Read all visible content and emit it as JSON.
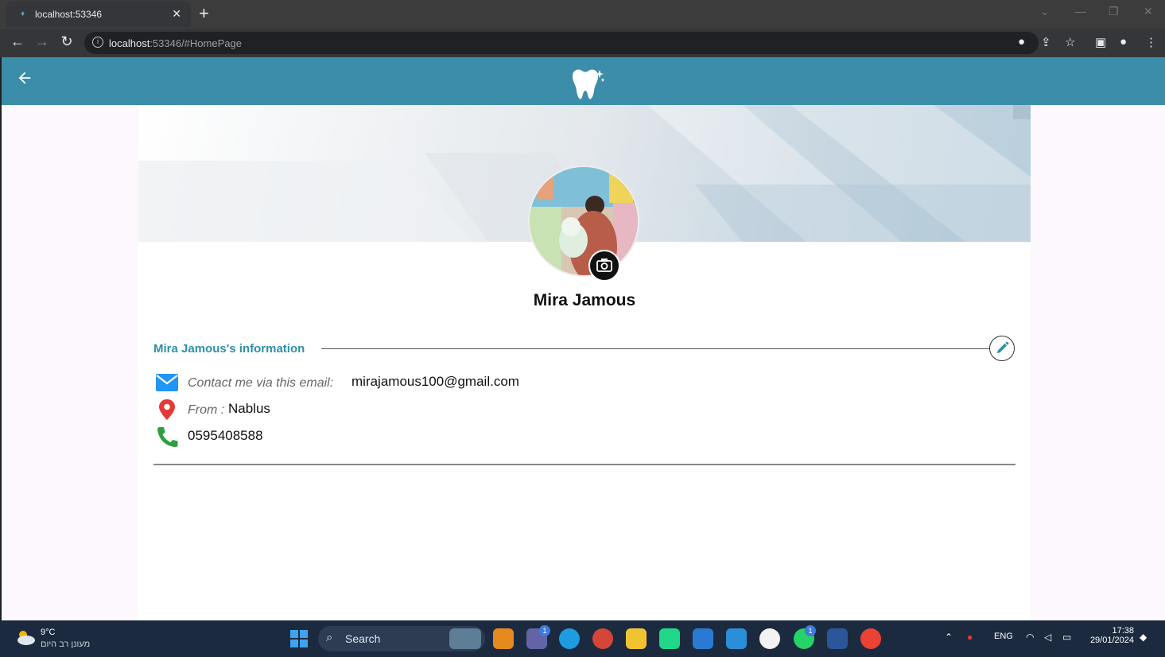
{
  "browser": {
    "tab_title": "localhost:53346",
    "url_host": "localhost",
    "url_rest": ":53346/#HomePage"
  },
  "profile": {
    "name": "Mira Jamous",
    "section_title": "Mira Jamous's information",
    "email_label": "Contact me via this email:",
    "email": "mirajamous100@gmail.com",
    "from_label": "From :",
    "city": "Nablus",
    "phone": "0595408588"
  },
  "taskbar": {
    "temp": "9°C",
    "weather_desc": "מעונן רב היום",
    "search_placeholder": "Search",
    "lang": "ENG",
    "time": "17:38",
    "date": "29/01/2024",
    "badge_1": "1",
    "badge_2": "1"
  },
  "colors": {
    "header": "#3b8da9",
    "accent_title": "#2e8fa8",
    "email_icon": "#2196f3",
    "location_icon": "#e53935",
    "phone_icon": "#2e9e3e"
  },
  "icons": {
    "back": "arrow-left-icon",
    "logo": "tooth-logo-icon",
    "camera": "camera-icon",
    "edit": "pencil-icon",
    "email": "envelope-icon",
    "location": "map-pin-icon",
    "phone": "phone-icon"
  }
}
